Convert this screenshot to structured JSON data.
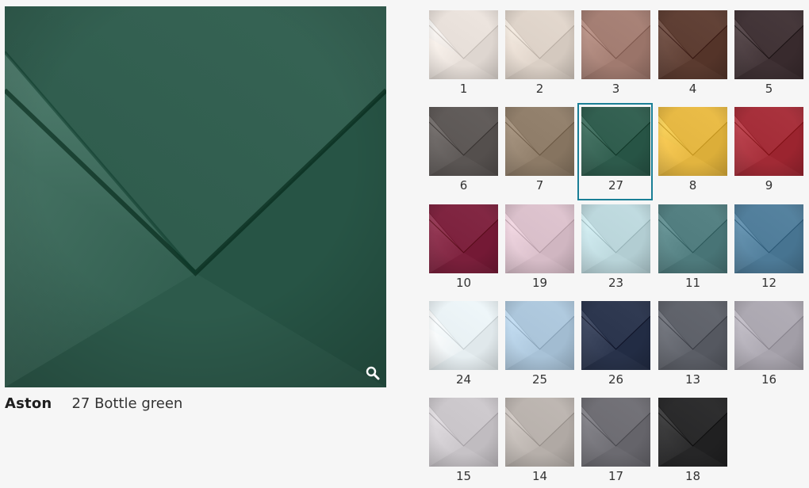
{
  "preview": {
    "color": "#2d5a4b",
    "zoom_icon": "magnifier-icon"
  },
  "caption": {
    "collection": "Aston",
    "color_name": "27 Bottle green"
  },
  "swatches": [
    {
      "number": "1",
      "color": "#e4dcd6",
      "selected": false
    },
    {
      "number": "2",
      "color": "#dacfc5",
      "selected": false
    },
    {
      "number": "3",
      "color": "#a07a6f",
      "selected": false
    },
    {
      "number": "4",
      "color": "#5a3a2f",
      "selected": false
    },
    {
      "number": "5",
      "color": "#3e3033",
      "selected": false
    },
    {
      "number": "6",
      "color": "#5a5553",
      "selected": false
    },
    {
      "number": "7",
      "color": "#8c7a66",
      "selected": false
    },
    {
      "number": "27",
      "color": "#2d5a4b",
      "selected": true
    },
    {
      "number": "8",
      "color": "#e2b43f",
      "selected": false
    },
    {
      "number": "9",
      "color": "#a12a35",
      "selected": false
    },
    {
      "number": "10",
      "color": "#7a1f3b",
      "selected": false
    },
    {
      "number": "19",
      "color": "#d6bcc7",
      "selected": false
    },
    {
      "number": "23",
      "color": "#b8d3d8",
      "selected": false
    },
    {
      "number": "11",
      "color": "#4e7a7c",
      "selected": false
    },
    {
      "number": "12",
      "color": "#4d7a97",
      "selected": false
    },
    {
      "number": "24",
      "color": "#e6eef1",
      "selected": false
    },
    {
      "number": "25",
      "color": "#a8c2d7",
      "selected": false
    },
    {
      "number": "26",
      "color": "#28324a",
      "selected": false
    },
    {
      "number": "13",
      "color": "#5b5e66",
      "selected": false
    },
    {
      "number": "16",
      "color": "#a8a4ad",
      "selected": false
    },
    {
      "number": "15",
      "color": "#c6c2c6",
      "selected": false
    },
    {
      "number": "14",
      "color": "#b6afaa",
      "selected": false
    },
    {
      "number": "17",
      "color": "#6b6a70",
      "selected": false
    },
    {
      "number": "18",
      "color": "#262627",
      "selected": false
    }
  ]
}
